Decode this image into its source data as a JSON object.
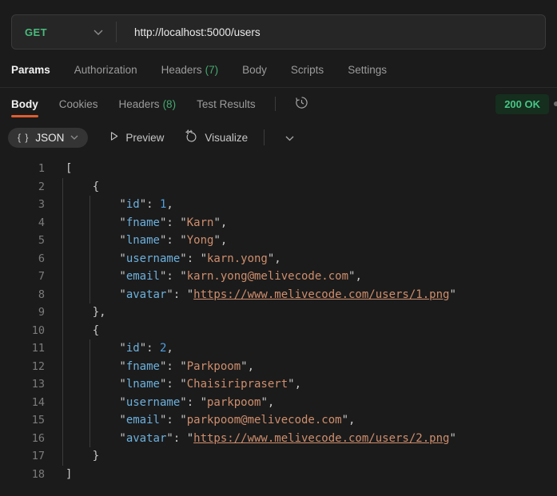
{
  "colors": {
    "method_green": "#49bb7b",
    "count_green": "#43a96f",
    "status_green": "#47c584",
    "status_bg": "#152e1e",
    "accent_orange": "#e05d30",
    "key": "#6cb0dd",
    "string": "#cf8e6d",
    "number": "#4f9fe0"
  },
  "request": {
    "method": "GET",
    "url": "http://localhost:5000/users",
    "tabs": [
      {
        "label": "Params",
        "count": ""
      },
      {
        "label": "Authorization",
        "count": ""
      },
      {
        "label": "Headers",
        "count": "(7)"
      },
      {
        "label": "Body",
        "count": ""
      },
      {
        "label": "Scripts",
        "count": ""
      },
      {
        "label": "Settings",
        "count": ""
      }
    ]
  },
  "response": {
    "tabs": [
      {
        "label": "Body",
        "count": ""
      },
      {
        "label": "Cookies",
        "count": ""
      },
      {
        "label": "Headers",
        "count": "(8)"
      },
      {
        "label": "Test Results",
        "count": ""
      }
    ],
    "status": "200 OK",
    "body_users": [
      {
        "id": 1,
        "fname": "Karn",
        "lname": "Yong",
        "username": "karn.yong",
        "email": "karn.yong@melivecode.com",
        "avatar": "https://www.melivecode.com/users/1.png"
      },
      {
        "id": 2,
        "fname": "Parkpoom",
        "lname": "Chaisiriprasert",
        "username": "parkpoom",
        "email": "parkpoom@melivecode.com",
        "avatar": "https://www.melivecode.com/users/2.png"
      }
    ]
  },
  "viewer": {
    "braces_glyph": "{ }",
    "format": "JSON",
    "preview": "Preview",
    "visualize": "Visualize"
  },
  "code": {
    "lines": [
      {
        "num": "1",
        "indent": 0,
        "tokens": [
          {
            "t": "p",
            "v": "["
          }
        ]
      },
      {
        "num": "2",
        "indent": 1,
        "tokens": [
          {
            "t": "p",
            "v": "{"
          }
        ]
      },
      {
        "num": "3",
        "indent": 2,
        "tokens": [
          {
            "t": "p",
            "v": "\""
          },
          {
            "t": "k",
            "v": "id"
          },
          {
            "t": "p",
            "v": "\""
          },
          {
            "t": "p",
            "v": ": "
          },
          {
            "t": "n",
            "v": "1"
          },
          {
            "t": "p",
            "v": ","
          }
        ]
      },
      {
        "num": "4",
        "indent": 2,
        "tokens": [
          {
            "t": "p",
            "v": "\""
          },
          {
            "t": "k",
            "v": "fname"
          },
          {
            "t": "p",
            "v": "\""
          },
          {
            "t": "p",
            "v": ": "
          },
          {
            "t": "p",
            "v": "\""
          },
          {
            "t": "s",
            "v": "Karn"
          },
          {
            "t": "p",
            "v": "\""
          },
          {
            "t": "p",
            "v": ","
          }
        ]
      },
      {
        "num": "5",
        "indent": 2,
        "tokens": [
          {
            "t": "p",
            "v": "\""
          },
          {
            "t": "k",
            "v": "lname"
          },
          {
            "t": "p",
            "v": "\""
          },
          {
            "t": "p",
            "v": ": "
          },
          {
            "t": "p",
            "v": "\""
          },
          {
            "t": "s",
            "v": "Yong"
          },
          {
            "t": "p",
            "v": "\""
          },
          {
            "t": "p",
            "v": ","
          }
        ]
      },
      {
        "num": "6",
        "indent": 2,
        "tokens": [
          {
            "t": "p",
            "v": "\""
          },
          {
            "t": "k",
            "v": "username"
          },
          {
            "t": "p",
            "v": "\""
          },
          {
            "t": "p",
            "v": ": "
          },
          {
            "t": "p",
            "v": "\""
          },
          {
            "t": "s",
            "v": "karn.yong"
          },
          {
            "t": "p",
            "v": "\""
          },
          {
            "t": "p",
            "v": ","
          }
        ]
      },
      {
        "num": "7",
        "indent": 2,
        "tokens": [
          {
            "t": "p",
            "v": "\""
          },
          {
            "t": "k",
            "v": "email"
          },
          {
            "t": "p",
            "v": "\""
          },
          {
            "t": "p",
            "v": ": "
          },
          {
            "t": "p",
            "v": "\""
          },
          {
            "t": "s",
            "v": "karn.yong@melivecode.com"
          },
          {
            "t": "p",
            "v": "\""
          },
          {
            "t": "p",
            "v": ","
          }
        ]
      },
      {
        "num": "8",
        "indent": 2,
        "tokens": [
          {
            "t": "p",
            "v": "\""
          },
          {
            "t": "k",
            "v": "avatar"
          },
          {
            "t": "p",
            "v": "\""
          },
          {
            "t": "p",
            "v": ": "
          },
          {
            "t": "p",
            "v": "\""
          },
          {
            "t": "u",
            "v": "https://www.melivecode.com/users/1.png"
          },
          {
            "t": "p",
            "v": "\""
          }
        ]
      },
      {
        "num": "9",
        "indent": 1,
        "tokens": [
          {
            "t": "p",
            "v": "},"
          }
        ]
      },
      {
        "num": "10",
        "indent": 1,
        "tokens": [
          {
            "t": "p",
            "v": "{"
          }
        ]
      },
      {
        "num": "11",
        "indent": 2,
        "tokens": [
          {
            "t": "p",
            "v": "\""
          },
          {
            "t": "k",
            "v": "id"
          },
          {
            "t": "p",
            "v": "\""
          },
          {
            "t": "p",
            "v": ": "
          },
          {
            "t": "n",
            "v": "2"
          },
          {
            "t": "p",
            "v": ","
          }
        ]
      },
      {
        "num": "12",
        "indent": 2,
        "tokens": [
          {
            "t": "p",
            "v": "\""
          },
          {
            "t": "k",
            "v": "fname"
          },
          {
            "t": "p",
            "v": "\""
          },
          {
            "t": "p",
            "v": ": "
          },
          {
            "t": "p",
            "v": "\""
          },
          {
            "t": "s",
            "v": "Parkpoom"
          },
          {
            "t": "p",
            "v": "\""
          },
          {
            "t": "p",
            "v": ","
          }
        ]
      },
      {
        "num": "13",
        "indent": 2,
        "tokens": [
          {
            "t": "p",
            "v": "\""
          },
          {
            "t": "k",
            "v": "lname"
          },
          {
            "t": "p",
            "v": "\""
          },
          {
            "t": "p",
            "v": ": "
          },
          {
            "t": "p",
            "v": "\""
          },
          {
            "t": "s",
            "v": "Chaisiriprasert"
          },
          {
            "t": "p",
            "v": "\""
          },
          {
            "t": "p",
            "v": ","
          }
        ]
      },
      {
        "num": "14",
        "indent": 2,
        "tokens": [
          {
            "t": "p",
            "v": "\""
          },
          {
            "t": "k",
            "v": "username"
          },
          {
            "t": "p",
            "v": "\""
          },
          {
            "t": "p",
            "v": ": "
          },
          {
            "t": "p",
            "v": "\""
          },
          {
            "t": "s",
            "v": "parkpoom"
          },
          {
            "t": "p",
            "v": "\""
          },
          {
            "t": "p",
            "v": ","
          }
        ]
      },
      {
        "num": "15",
        "indent": 2,
        "tokens": [
          {
            "t": "p",
            "v": "\""
          },
          {
            "t": "k",
            "v": "email"
          },
          {
            "t": "p",
            "v": "\""
          },
          {
            "t": "p",
            "v": ": "
          },
          {
            "t": "p",
            "v": "\""
          },
          {
            "t": "s",
            "v": "parkpoom@melivecode.com"
          },
          {
            "t": "p",
            "v": "\""
          },
          {
            "t": "p",
            "v": ","
          }
        ]
      },
      {
        "num": "16",
        "indent": 2,
        "tokens": [
          {
            "t": "p",
            "v": "\""
          },
          {
            "t": "k",
            "v": "avatar"
          },
          {
            "t": "p",
            "v": "\""
          },
          {
            "t": "p",
            "v": ": "
          },
          {
            "t": "p",
            "v": "\""
          },
          {
            "t": "u",
            "v": "https://www.melivecode.com/users/2.png"
          },
          {
            "t": "p",
            "v": "\""
          }
        ]
      },
      {
        "num": "17",
        "indent": 1,
        "tokens": [
          {
            "t": "p",
            "v": "}"
          }
        ]
      },
      {
        "num": "18",
        "indent": 0,
        "tokens": [
          {
            "t": "p",
            "v": "]"
          }
        ]
      }
    ]
  }
}
